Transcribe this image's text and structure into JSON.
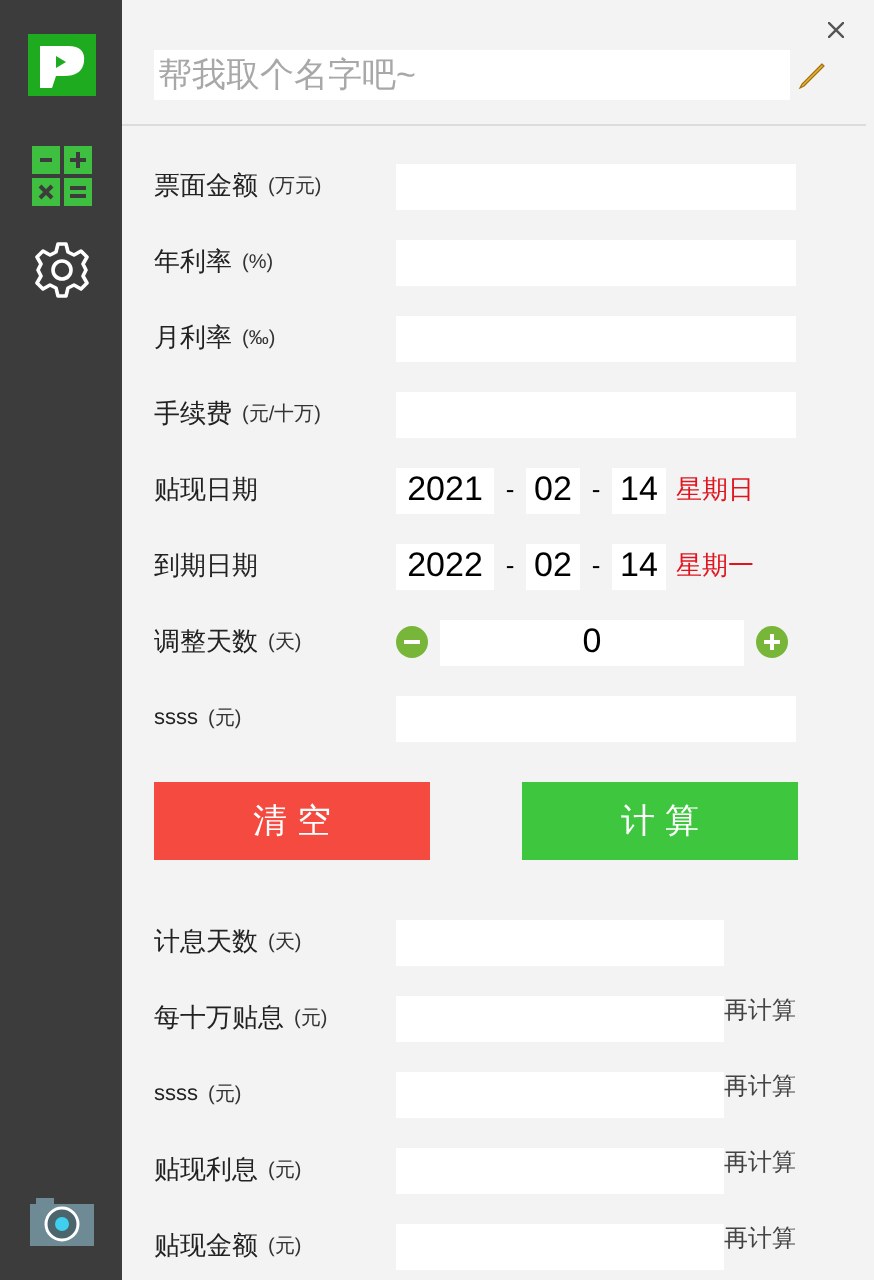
{
  "name_field": {
    "placeholder": "帮我取个名字吧~"
  },
  "inputs": [
    {
      "kind": "text",
      "label": "票面金额",
      "unit": "(万元)"
    },
    {
      "kind": "text",
      "label": "年利率",
      "unit": "(%)"
    },
    {
      "kind": "text",
      "label": "月利率",
      "unit": "(‰)"
    },
    {
      "kind": "text",
      "label": "手续费",
      "unit": "(元/十万)"
    },
    {
      "kind": "date",
      "label": "贴现日期",
      "year": "2021",
      "separator_1": "-",
      "month": "02",
      "separator_2": "-",
      "day": "14",
      "weekday": "星期日"
    },
    {
      "kind": "date",
      "label": "到期日期",
      "year": "2022",
      "separator_1": "-",
      "month": "02",
      "separator_2": "-",
      "day": "14",
      "weekday": "星期一"
    },
    {
      "kind": "stepper",
      "label": "调整天数",
      "unit": "(天)",
      "value": "0"
    },
    {
      "kind": "text",
      "label": "ssss",
      "unit": "(元)"
    }
  ],
  "buttons": [
    {
      "kind": "clear",
      "label": "清 空"
    },
    {
      "kind": "calculate",
      "label": "计 算"
    }
  ],
  "results": [
    {
      "label": "计息天数",
      "unit": "(天)"
    },
    {
      "label": "每十万贴息",
      "unit": "(元)",
      "action": "再计算"
    },
    {
      "label": "ssss",
      "unit": "(元)",
      "action": "再计算"
    },
    {
      "label": "贴现利息",
      "unit": "(元)",
      "action": "再计算"
    },
    {
      "label": "贴现金额",
      "unit": "(元)",
      "action": "再计算"
    }
  ]
}
